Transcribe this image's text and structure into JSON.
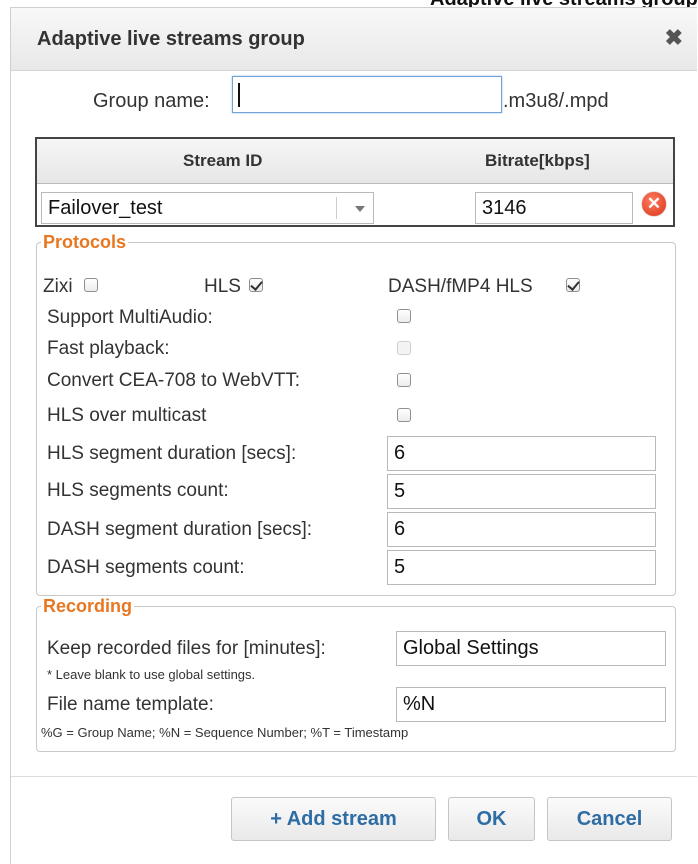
{
  "top_cutoff_text": "Adaptive live streams group pop-up window (example)",
  "dialog": {
    "title": "Adaptive live streams group",
    "close_icon": "close-x-icon"
  },
  "group": {
    "label": "Group name:",
    "value": "",
    "suffix": ".m3u8/.mpd"
  },
  "streams": {
    "headers": {
      "stream_id": "Stream ID",
      "bitrate": "Bitrate[kbps]"
    },
    "rows": [
      {
        "stream_id": "Failover_test",
        "bitrate": "3146",
        "remove_icon": "remove-circle-icon"
      }
    ]
  },
  "protocols": {
    "legend": "Protocols",
    "zixi": {
      "label": "Zixi",
      "checked": false
    },
    "hls": {
      "label": "HLS",
      "checked": true
    },
    "dash": {
      "label": "DASH/fMP4 HLS",
      "checked": true
    },
    "support_multiaudio": {
      "label": "Support MultiAudio:",
      "checked": false
    },
    "fast_playback": {
      "label": "Fast playback:",
      "checked": false,
      "disabled": true
    },
    "convert_cea": {
      "label": "Convert CEA-708 to WebVTT:",
      "checked": false
    },
    "hls_multicast": {
      "label": "HLS over multicast",
      "checked": false
    },
    "hls_seg_duration": {
      "label": "HLS segment duration [secs]:",
      "value": "6"
    },
    "hls_seg_count": {
      "label": "HLS segments count:",
      "value": "5"
    },
    "dash_seg_duration": {
      "label": "DASH segment duration [secs]:",
      "value": "6"
    },
    "dash_seg_count": {
      "label": "DASH segments count:",
      "value": "5"
    }
  },
  "recording": {
    "legend": "Recording",
    "keep_label": "Keep recorded files for [minutes]:",
    "keep_value": "Global Settings",
    "keep_note": "* Leave blank to use global settings.",
    "template_label": "File name template:",
    "template_value": "%N",
    "template_note": "%G = Group Name; %N = Sequence Number; %T = Timestamp"
  },
  "buttons": {
    "add_stream": "+ Add stream",
    "ok": "OK",
    "cancel": "Cancel"
  }
}
